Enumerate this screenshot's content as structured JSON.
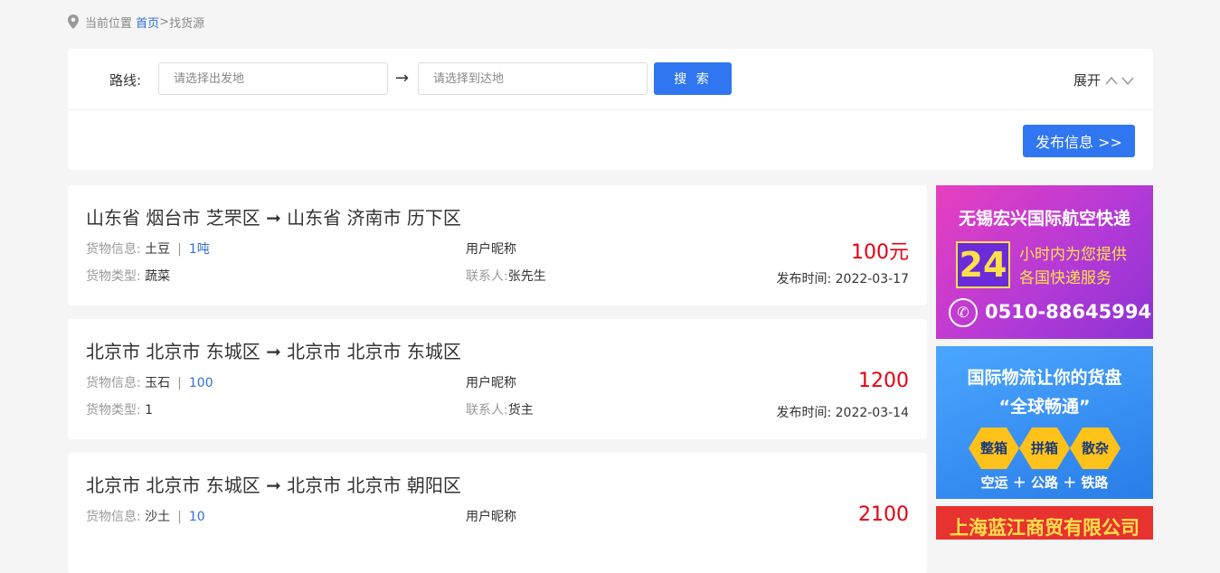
{
  "breadcrumb": {
    "prefix": "当前位置",
    "home": "首页",
    "sep": ">",
    "current": "找货源"
  },
  "search": {
    "route_label": "路线:",
    "from_placeholder": "请选择出发地",
    "to_placeholder": "请选择到达地",
    "arrow": "→",
    "button": "搜 索",
    "expand": "展开",
    "publish": "发布信息 >>"
  },
  "listings": [
    {
      "route": "山东省 烟台市 芝罘区 ➞ 山东省 济南市 历下区",
      "goods_label": "货物信息:",
      "goods": "土豆",
      "qty": "1吨",
      "type_label": "货物类型:",
      "type": "蔬菜",
      "nickname": "用户昵称",
      "contact_label": "联系人:",
      "contact": "张先生",
      "price": "100元",
      "date_label": "发布时间:",
      "date": "2022-03-17"
    },
    {
      "route": "北京市 北京市 东城区 ➞ 北京市 北京市 东城区",
      "goods_label": "货物信息:",
      "goods": "玉石",
      "qty": "100",
      "type_label": "货物类型:",
      "type": "1",
      "nickname": "用户昵称",
      "contact_label": "联系人:",
      "contact": "货主",
      "price": "1200",
      "date_label": "发布时间:",
      "date": "2022-03-14"
    },
    {
      "route": "北京市 北京市 东城区 ➞ 北京市 北京市 朝阳区",
      "goods_label": "货物信息:",
      "goods": "沙土",
      "qty": "10",
      "nickname": "用户昵称",
      "price": "2100"
    }
  ],
  "ads": {
    "ad1": {
      "title": "无锡宏兴国际航空快递",
      "num": "24",
      "line1": "小时内为您提供",
      "line2": "各国快递服务",
      "tel": "0510-88645994",
      "color": "#b53ad6"
    },
    "ad2": {
      "title1": "国际物流让你的货盘",
      "title2": "“全球畅通”",
      "tags": [
        "整箱",
        "拼箱",
        "散杂"
      ],
      "modes": "空运 ＋ 公路 ＋ 铁路",
      "color": "#2a7de8"
    },
    "ad3": {
      "title": "上海蓝江商贸有限公司",
      "color": "#e8322f"
    }
  },
  "colors": {
    "accent": "#2f76f0",
    "price": "#e60012",
    "link": "#2f6fd6"
  }
}
